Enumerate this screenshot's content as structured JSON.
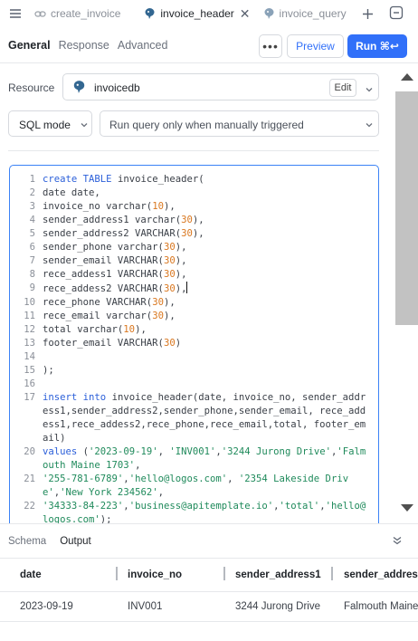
{
  "tabs": [
    {
      "label": "create_invoice",
      "active": false,
      "closable": false
    },
    {
      "label": "invoice_header",
      "active": true,
      "closable": true
    },
    {
      "label": "invoice_query",
      "active": false,
      "closable": false
    }
  ],
  "subtabs": [
    "General",
    "Response",
    "Advanced"
  ],
  "toolbar": {
    "more": "•••",
    "preview": "Preview",
    "run": "Run ⌘↩"
  },
  "resource": {
    "label": "Resource",
    "value": "invoicedb",
    "edit": "Edit"
  },
  "mode": {
    "value": "SQL mode"
  },
  "trigger": {
    "value": "Run query only when manually triggered"
  },
  "code_lines": [
    {
      "n": "1",
      "t": "create TABLE invoice_header("
    },
    {
      "n": "2",
      "t": "date date,"
    },
    {
      "n": "3",
      "t": "invoice_no varchar(10),"
    },
    {
      "n": "4",
      "t": "sender_address1 varchar(30),"
    },
    {
      "n": "5",
      "t": "sender_address2 VARCHAR(30),"
    },
    {
      "n": "6",
      "t": "sender_phone varchar(30),"
    },
    {
      "n": "7",
      "t": "sender_email VARCHAR(30),"
    },
    {
      "n": "8",
      "t": "rece_addess1 VARCHAR(30),"
    },
    {
      "n": "9",
      "t": "rece_addess2 VARCHAR(30),"
    },
    {
      "n": "10",
      "t": "rece_phone VARCHAR(30),"
    },
    {
      "n": "11",
      "t": "rece_email varchar(30),"
    },
    {
      "n": "12",
      "t": "total varchar(10),"
    },
    {
      "n": "13",
      "t": "footer_email VARCHAR(30)"
    },
    {
      "n": "14",
      "t": ""
    },
    {
      "n": "15",
      "t": ");"
    },
    {
      "n": "16",
      "t": ""
    },
    {
      "n": "17",
      "t": "insert into invoice_header(date, invoice_no, sender_address1,sender_address2,sender_phone,sender_email, rece_addess1,rece_addess2,rece_phone,rece_email,total, footer_email)"
    },
    {
      "n": "20",
      "t": "values ('2023-09-19', 'INV001','3244 Jurong Drive','Falmouth Maine 1703',"
    },
    {
      "n": "21",
      "t": "'255-781-6789','hello@logos.com', '2354 Lakeside Drive','New York 234562',"
    },
    {
      "n": "22",
      "t": "'34333-84-223','business@apitemplate.io','total','hello@logos.com');"
    }
  ],
  "output": {
    "tabs": [
      "Schema",
      "Output"
    ],
    "active": "Output"
  },
  "table": {
    "columns": [
      "date",
      "invoice_no",
      "sender_address1",
      "sender_addres"
    ],
    "rows": [
      [
        "2023-09-19",
        "INV001",
        "3244 Jurong Drive",
        "Falmouth Maine"
      ]
    ]
  },
  "colors": {
    "accent": "#3170f9",
    "keyword": "#2b5fd9",
    "number": "#d9771f",
    "string": "#1f8a5b"
  },
  "icons": [
    "menu-icon",
    "chain-icon",
    "postgres-icon",
    "close-icon",
    "plus-icon",
    "collapse-icon",
    "chevron-down-icon",
    "scroll-up-icon",
    "scroll-down-icon"
  ]
}
